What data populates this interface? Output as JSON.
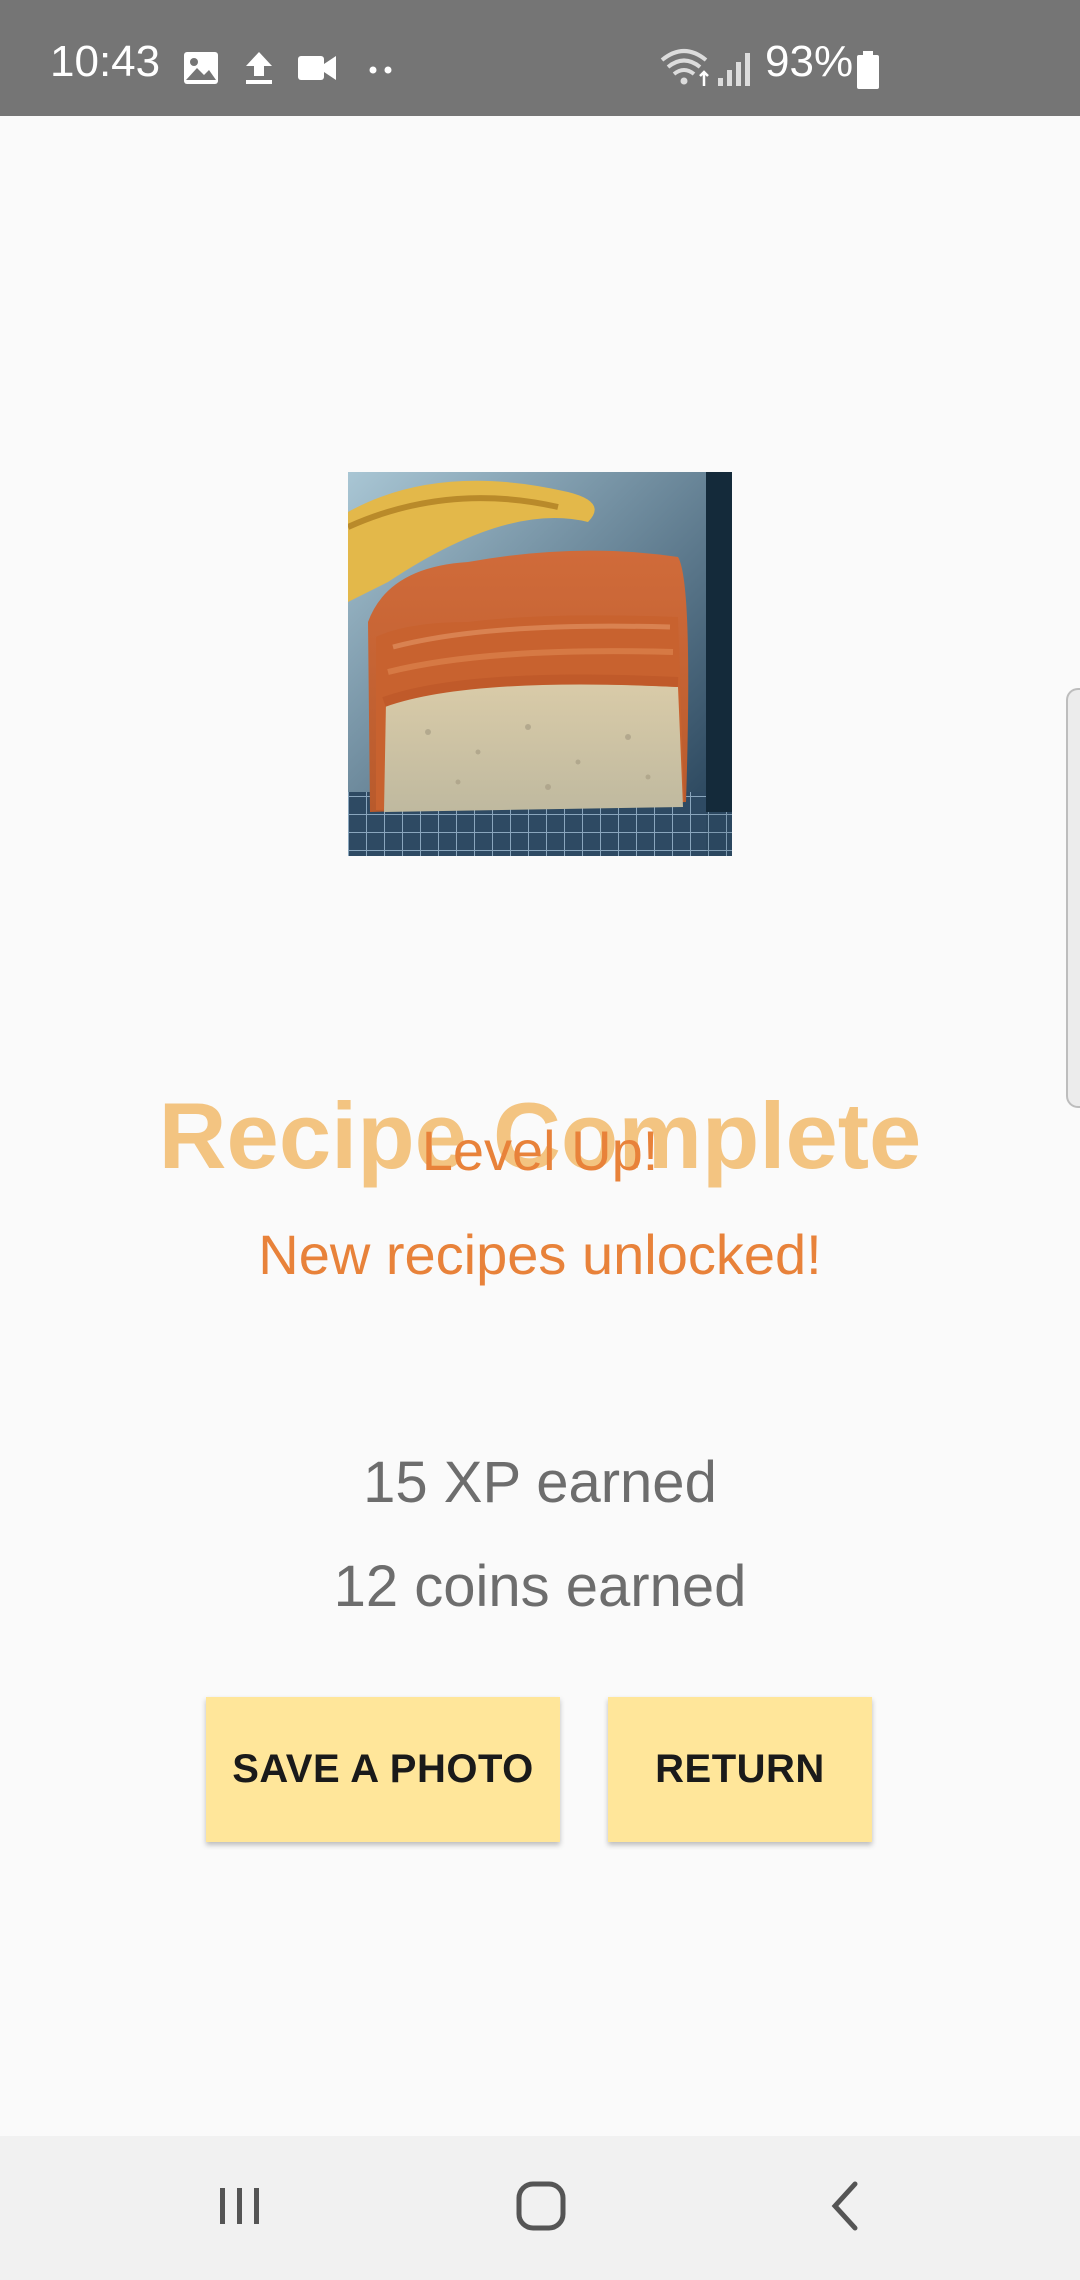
{
  "status_bar": {
    "time": "10:43",
    "battery": "93%",
    "icons": [
      "image-icon",
      "upload-icon",
      "video-camera-icon",
      "more-dots-icon",
      "wifi-icon",
      "signal-icon",
      "battery-icon"
    ]
  },
  "recipe": {
    "image_alt_icon": "banana-bread-photo"
  },
  "result": {
    "title": "Recipe Complete",
    "level_up": "Level Up!",
    "unlocked": "New recipes unlocked!",
    "xp": "15 XP earned",
    "coins": "12 coins earned"
  },
  "actions": {
    "save_label": "SAVE A PHOTO",
    "return_label": "RETURN"
  },
  "nav": {
    "icons": [
      "recent-apps-icon",
      "home-icon",
      "back-icon"
    ]
  },
  "colors": {
    "status_bar": "#757575",
    "title": "#f3c481",
    "accent": "#e8823a",
    "button": "#ffe69a",
    "earn_text": "#6d6d6d"
  }
}
